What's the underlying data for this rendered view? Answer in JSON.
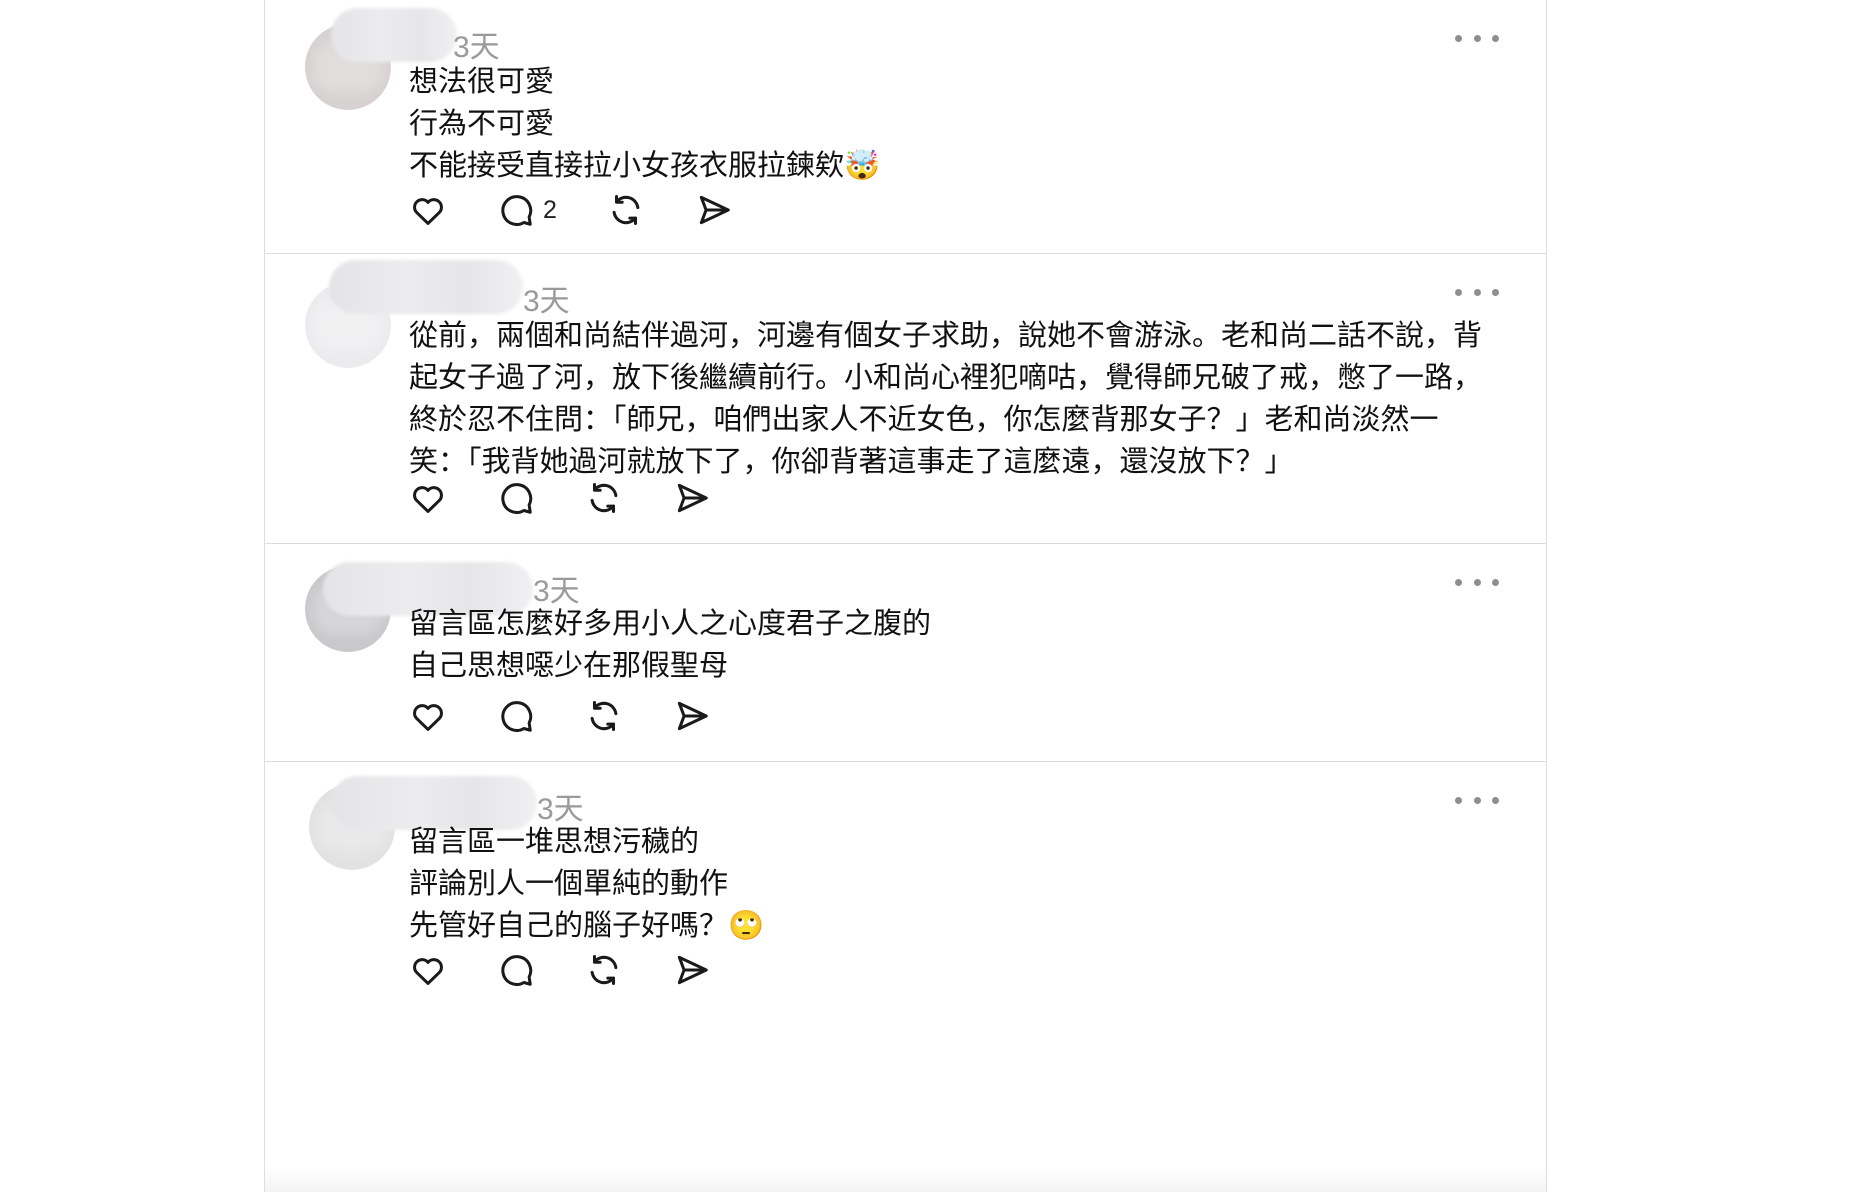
{
  "comments": [
    {
      "time": "3天",
      "lines": [
        "想法很可愛",
        "行為不可愛",
        "不能接受直接拉小女孩衣服拉鍊欸🤯"
      ],
      "reply_count": "2"
    },
    {
      "time": "3天",
      "lines": [
        "從前，兩個和尚結伴過河，河邊有個女子求助，說她不會游泳。老和尚二話不說，背起女子過了河，放下後繼續前行。小和尚心裡犯嘀咕，覺得師兄破了戒，憋了一路，終於忍不住問：「師兄，咱們出家人不近女色，你怎麼背那女子？」老和尚淡然一笑：「我背她過河就放下了，你卻背著這事走了這麼遠，還沒放下？」"
      ],
      "reply_count": ""
    },
    {
      "time": "3天",
      "lines": [
        "留言區怎麼好多用小人之心度君子之腹的",
        "自己思想噁少在那假聖母"
      ],
      "reply_count": ""
    },
    {
      "time": "3天",
      "lines": [
        "留言區一堆思想污穢的",
        "評論別人一個單純的動作",
        "先管好自己的腦子好嗎？🙄"
      ],
      "reply_count": ""
    }
  ],
  "icons": {
    "like": "heart-icon",
    "reply": "comment-bubble-icon",
    "repost": "repost-icon",
    "share": "send-icon",
    "more": "more-dots-icon"
  },
  "colors": {
    "text": "#111111",
    "muted": "#9a9a9a",
    "divider": "#dcdcdc",
    "icon": "#1a1a1a"
  }
}
